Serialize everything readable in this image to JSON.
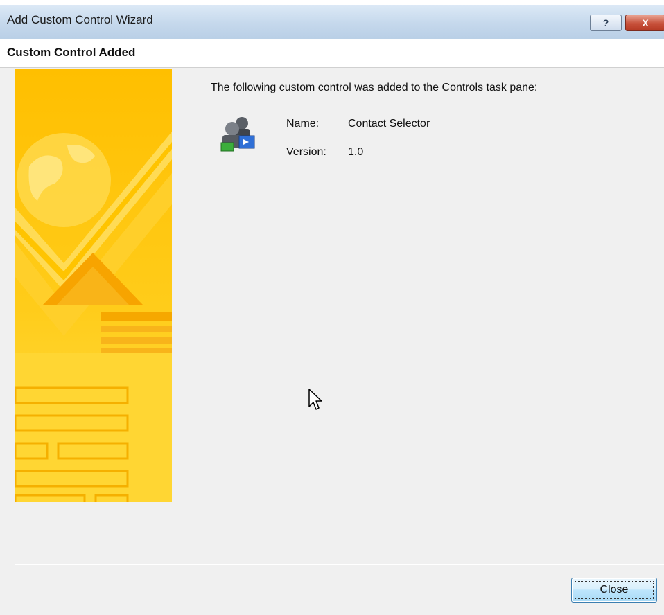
{
  "window": {
    "title": "Add Custom Control Wizard",
    "help_button_glyph": "?",
    "close_button_glyph": "X"
  },
  "header": {
    "title": "Custom Control Added"
  },
  "body": {
    "message": "The following custom control was added to the Controls task pane:",
    "control_icon": "people-icon",
    "name_label": "Name:",
    "name_value": "Contact Selector",
    "version_label": "Version:",
    "version_value": "1.0"
  },
  "footer": {
    "close_mnemonic": "C",
    "close_rest": "lose"
  },
  "colors": {
    "titlebar": "#c5d8ec",
    "art_yellow": "#ffc20e",
    "close_button_blue": "#bee6fd",
    "window_close_red": "#c7503a"
  }
}
